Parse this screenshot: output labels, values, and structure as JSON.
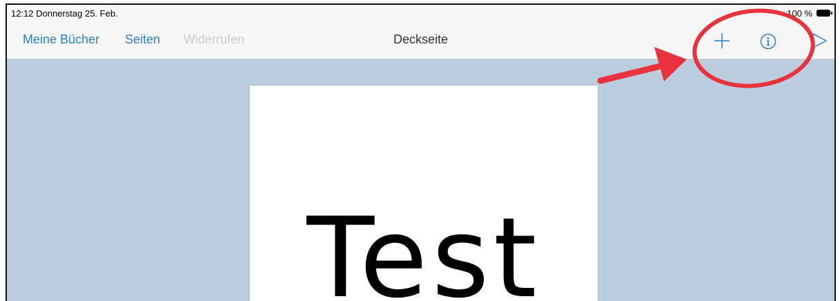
{
  "status_bar": {
    "time_date": "12:12  Donnerstag 25. Feb.",
    "battery_percent": "100 %"
  },
  "nav_bar": {
    "my_books_label": "Meine Bücher",
    "pages_label": "Seiten",
    "undo_label": "Widerrufen",
    "title": "Deckseite",
    "icons": [
      "plus-icon",
      "info-icon",
      "play-icon"
    ]
  },
  "page": {
    "text": "Test"
  },
  "colors": {
    "accent": "#2a7fd1",
    "canvas_background": "#bccddf",
    "annotation_red": "#e8333f"
  }
}
